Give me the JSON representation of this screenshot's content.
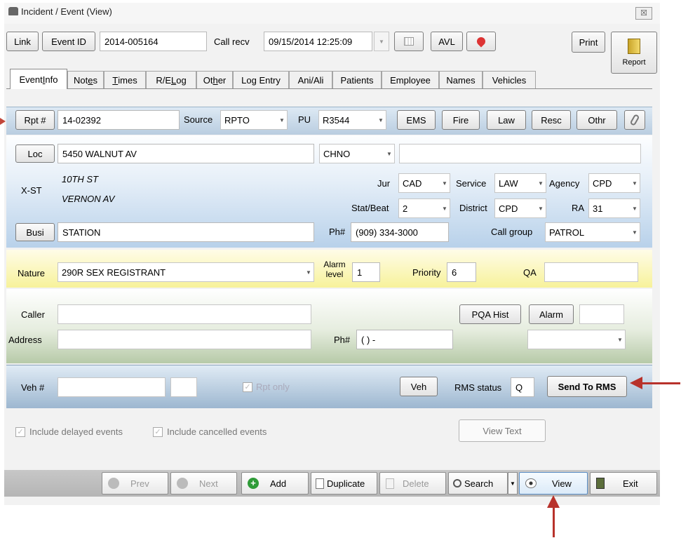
{
  "window": {
    "title": "Incident / Event (View)",
    "close_label": "☒"
  },
  "header": {
    "link_label": "Link",
    "event_id_label": "Event ID",
    "event_id_value": "2014-005164",
    "call_recv_label": "Call recv",
    "call_recv_value": "09/15/2014 12:25:09",
    "avl_label": "AVL",
    "print_label": "Print",
    "report_label": "Report"
  },
  "tabs": [
    {
      "pre": "Event ",
      "ul": "I",
      "post": "nfo"
    },
    {
      "pre": "Not",
      "ul": "e",
      "post": "s"
    },
    {
      "pre": "",
      "ul": "T",
      "post": "imes"
    },
    {
      "pre": "R/E ",
      "ul": "L",
      "post": "og"
    },
    {
      "pre": "Ot",
      "ul": "h",
      "post": "er"
    },
    {
      "pre": "Log Entry",
      "ul": "",
      "post": ""
    },
    {
      "pre": "Ani/Ali",
      "ul": "",
      "post": ""
    },
    {
      "pre": "Patients",
      "ul": "",
      "post": ""
    },
    {
      "pre": "Employee",
      "ul": "",
      "post": ""
    },
    {
      "pre": "Names",
      "ul": "",
      "post": ""
    },
    {
      "pre": "Vehicles",
      "ul": "",
      "post": ""
    }
  ],
  "report_row": {
    "rpt_label": "Rpt #",
    "rpt_value": "14-02392",
    "source_label": "Source",
    "source_value": "RPTO",
    "pu_label": "PU",
    "pu_value": "R3544",
    "buttons": [
      "EMS",
      "Fire",
      "Law",
      "Resc",
      "Othr"
    ]
  },
  "location": {
    "loc_label": "Loc",
    "loc_value": "5450 WALNUT AV",
    "city_value": "CHNO",
    "xst_label": "X-ST",
    "xst1": "10TH ST",
    "xst2": "VERNON AV",
    "jur_label": "Jur",
    "jur_value": "CAD",
    "service_label": "Service",
    "service_value": "LAW",
    "agency_label": "Agency",
    "agency_value": "CPD",
    "statbeat_label": "Stat/Beat",
    "statbeat_value": "2",
    "district_label": "District",
    "district_value": "CPD",
    "ra_label": "RA",
    "ra_value": "31",
    "busi_label": "Busi",
    "busi_value": "STATION",
    "ph_label": "Ph#",
    "ph_value": "(909) 334-3000",
    "callgroup_label": "Call group",
    "callgroup_value": "PATROL"
  },
  "nature": {
    "nature_label": "Nature",
    "nature_value": "290R  SEX REGISTRANT",
    "alarm_label_1": "Alarm",
    "alarm_label_2": "level",
    "alarm_value": "1",
    "priority_label": "Priority",
    "priority_value": "6",
    "qa_label": "QA"
  },
  "caller": {
    "caller_label": "Caller",
    "address_label": "Address",
    "ph_label": "Ph#",
    "ph_value": "(      )        -",
    "pqa_label": "PQA Hist",
    "alarm_label": "Alarm"
  },
  "vehicle": {
    "veh_label": "Veh #",
    "rpt_only_label": "Rpt only",
    "veh_button": "Veh",
    "rms_status_label": "RMS status",
    "rms_status_value": "Q",
    "send_rms_label": "Send To RMS"
  },
  "options": {
    "include_delayed": "Include delayed events",
    "include_cancelled": "Include cancelled events",
    "view_text": "View Text"
  },
  "toolbar": {
    "prev": "Prev",
    "next": "Next",
    "add": "Add",
    "duplicate": "Duplicate",
    "delete": "Delete",
    "search": "Search",
    "view": "View",
    "exit": "Exit"
  },
  "colors": {
    "annotation_arrow": "#b8322b",
    "yellow_band": "#f7f29a",
    "blue_band": "#b8d1ea",
    "green_band": "#b7caa8"
  }
}
